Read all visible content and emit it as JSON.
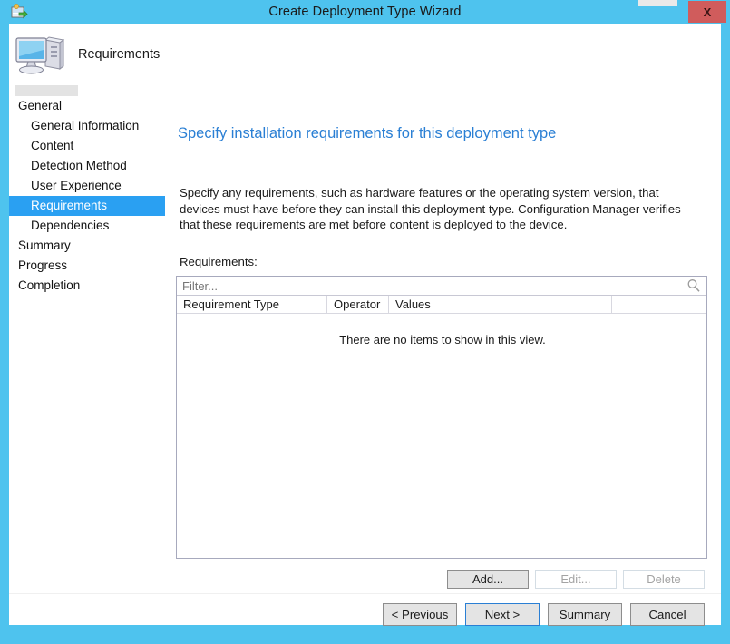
{
  "window": {
    "title": "Create Deployment Type Wizard",
    "title_icon": "deployment-package-icon",
    "close_label": "X",
    "frame_color": "#4ec3ee",
    "close_color": "#d05c5c"
  },
  "header": {
    "icon": "computer-monitor-icon",
    "label": "Requirements"
  },
  "nav": {
    "items": [
      {
        "label": "General",
        "level": 0,
        "selected": false
      },
      {
        "label": "General Information",
        "level": 1,
        "selected": false
      },
      {
        "label": "Content",
        "level": 1,
        "selected": false
      },
      {
        "label": "Detection Method",
        "level": 1,
        "selected": false
      },
      {
        "label": "User Experience",
        "level": 1,
        "selected": false
      },
      {
        "label": "Requirements",
        "level": 1,
        "selected": true
      },
      {
        "label": "Dependencies",
        "level": 1,
        "selected": false
      },
      {
        "label": "Summary",
        "level": 0,
        "selected": false
      },
      {
        "label": "Progress",
        "level": 0,
        "selected": false
      },
      {
        "label": "Completion",
        "level": 0,
        "selected": false
      }
    ],
    "selected_color": "#2aa0f2"
  },
  "main": {
    "heading": "Specify installation requirements for this deployment type",
    "heading_color": "#2a7fd4",
    "description": "Specify any requirements, such as hardware features or the operating system version, that devices must have before they can install this deployment type. Configuration Manager verifies that these requirements are met before content is deployed to the device.",
    "requirements_label": "Requirements:",
    "filter": {
      "placeholder": "Filter...",
      "value": "",
      "search_icon": "magnifier-icon"
    },
    "table": {
      "columns": [
        "Requirement Type",
        "Operator",
        "Values",
        ""
      ],
      "rows": [],
      "empty_message": "There are no items to show in this view."
    },
    "list_buttons": [
      {
        "label": "Add...",
        "enabled": true
      },
      {
        "label": "Edit...",
        "enabled": false
      },
      {
        "label": "Delete",
        "enabled": false
      }
    ]
  },
  "footer": {
    "buttons": [
      {
        "label": "< Previous",
        "default": false
      },
      {
        "label": "Next >",
        "default": true
      },
      {
        "label": "Summary",
        "default": false
      },
      {
        "label": "Cancel",
        "default": false
      }
    ]
  }
}
